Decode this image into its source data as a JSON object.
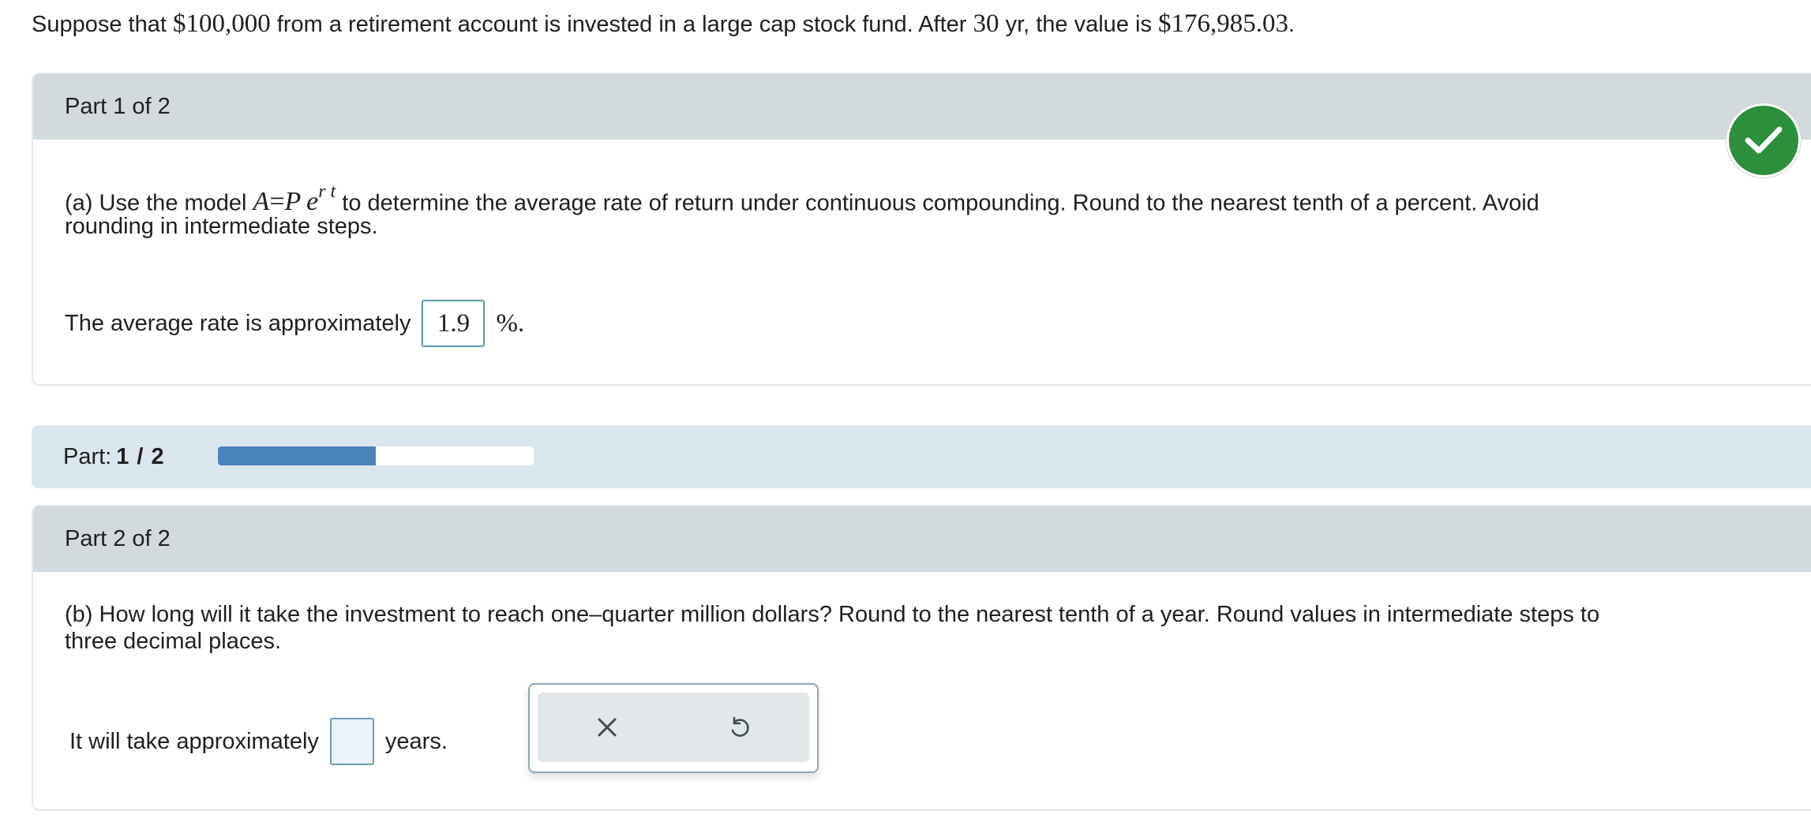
{
  "problem": {
    "text_1": "Suppose that ",
    "principal": "$100,000",
    "text_2": " from a retirement account is invested in a large cap stock fund. After ",
    "years": "30",
    "text_3": " yr, the value is ",
    "final_value": "$176,985.03",
    "text_4": "."
  },
  "part1": {
    "header": "Part 1 of 2",
    "status_icon": "checkmark-icon",
    "question_prefix": "(a) Use the model ",
    "formula_A": "A",
    "formula_eq": "=",
    "formula_P": "P",
    "formula_e": "e",
    "formula_exp": "r t",
    "question_suffix": " to determine the average rate of return under continuous compounding. Round to the nearest tenth of a percent. Avoid",
    "question_line2": "rounding in intermediate steps.",
    "answer_prefix": "The average rate is approximately",
    "answer_value": "1.9",
    "answer_unit": "%."
  },
  "progress": {
    "label": "Part:",
    "value": "1 / 2",
    "fraction": 0.5
  },
  "part2": {
    "header": "Part 2 of 2",
    "question_line1": "(b) How long will it take the investment to reach one–quarter million dollars? Round to the nearest tenth of a year. Round values in intermediate steps to",
    "question_line2": "three decimal places.",
    "answer_prefix": "It will take approximately",
    "answer_value": "",
    "answer_unit": "years."
  },
  "toolbar": {
    "clear_icon": "close-icon",
    "undo_icon": "undo-icon"
  },
  "colors": {
    "check_green": "#2c8f3c",
    "progress_fill": "#4a82bb",
    "header_gray": "#d3dadd",
    "progress_strip": "#dbe7ee"
  }
}
